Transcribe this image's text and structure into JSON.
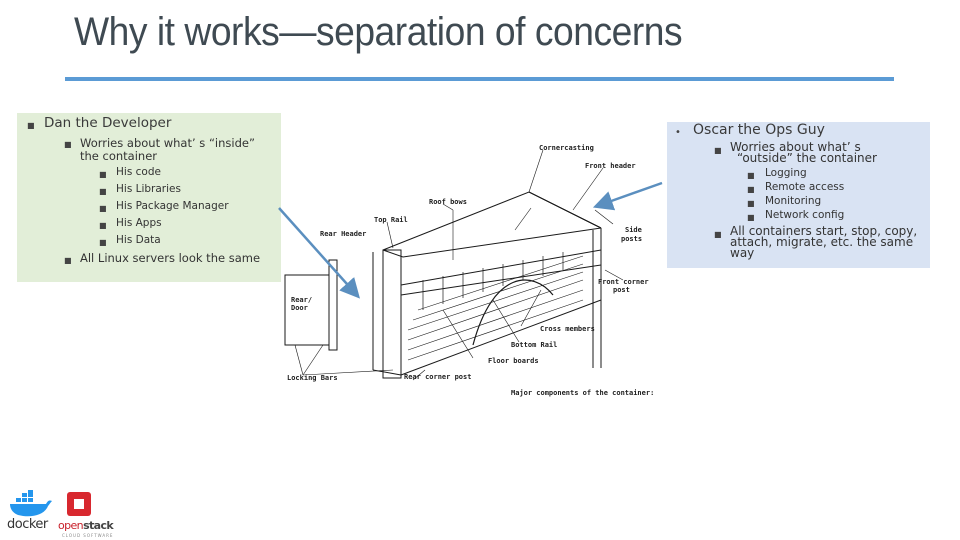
{
  "slide": {
    "title": "Why it works—separation of concerns",
    "accent_color": "#5b9bd5"
  },
  "left_panel": {
    "background": "#e2eed8",
    "heading": "Dan the Developer",
    "sub": {
      "item1_line1": "Worries about what’ s  “inside”",
      "item1_line2": "the container",
      "items": [
        "His code",
        "His Libraries",
        "His Package Manager",
        "His Apps",
        "His Data"
      ],
      "item2": "All Linux servers look the same"
    }
  },
  "right_panel": {
    "background": "#d9e3f3",
    "heading": "Oscar the Ops Guy",
    "sub": {
      "item1_line1": "Worries about what’ s",
      "item1_line2": "“outside”  the container",
      "items": [
        "Logging",
        "Remote access",
        "Monitoring",
        "Network config"
      ],
      "item2_line1": "All containers start, stop, copy,",
      "item2_line2": "attach, migrate, etc. the same",
      "item2_line3": "way"
    }
  },
  "diagram": {
    "caption": "Major components of the container:",
    "labels": {
      "cornercasting": "Cornercasting",
      "front_header": "Front header",
      "roof_bows": "Roof bows",
      "top_rail": "Top Rail",
      "rear_header": "Rear Header",
      "side_posts_1": "Side",
      "side_posts_2": "posts",
      "front_corner_post_1": "Front corner",
      "front_corner_post_2": "post",
      "rear_door_1": "Rear/",
      "rear_door_2": "Door",
      "cross_members": "Cross members",
      "bottom_rail": "Bottom Rail",
      "floor_boards": "Floor boards",
      "locking_bars": "Locking Bars",
      "rear_corner_post": "Rear corner post"
    }
  },
  "logos": {
    "docker": "docker",
    "openstack_open": "open",
    "openstack_stack": "stack",
    "openstack_sub": "CLOUD SOFTWARE"
  }
}
